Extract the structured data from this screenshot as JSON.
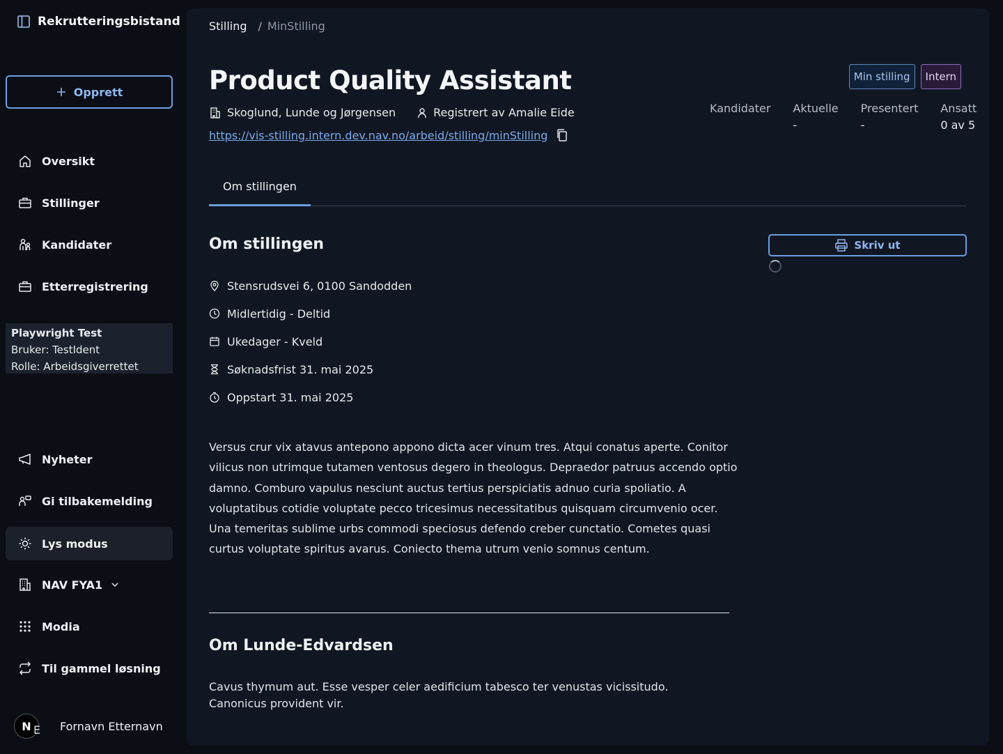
{
  "app": {
    "title": "Rekrutteringsbistand"
  },
  "sidebar": {
    "create_label": "Opprett",
    "nav": [
      {
        "label": "Oversikt",
        "icon": "house-icon"
      },
      {
        "label": "Stillinger",
        "icon": "briefcase-icon"
      },
      {
        "label": "Kandidater",
        "icon": "person-group-icon"
      },
      {
        "label": "Etterregistrering",
        "icon": "briefcase-icon"
      }
    ],
    "user_box": {
      "name": "Playwright Test",
      "user_line": "Bruker: TestIdent",
      "role_line": "Rolle: Arbeidsgiverrettet"
    },
    "bottom_nav": [
      {
        "label": "Nyheter",
        "icon": "megaphone-icon"
      },
      {
        "label": "Gi tilbakemelding",
        "icon": "feedback-icon"
      },
      {
        "label": "Lys modus",
        "icon": "sun-icon"
      },
      {
        "label": "NAV FYA1",
        "icon": "building-icon"
      },
      {
        "label": "Modia",
        "icon": "grid-dots-icon"
      },
      {
        "label": "Til gammel løsning",
        "icon": "arrows-circle-icon"
      }
    ],
    "profile": {
      "avatar_letter": "N",
      "initials": "E",
      "name": "Fornavn Etternavn"
    }
  },
  "breadcrumb": {
    "first": "Stilling",
    "separator": "/",
    "current": "MinStilling"
  },
  "job": {
    "title": "Product Quality Assistant",
    "employer": "Skoglund, Lunde og Jørgensen",
    "registered_by": "Registrert av Amalie Eide",
    "url": "https://vis-stilling.intern.dev.nav.no/arbeid/stilling/minStilling"
  },
  "badges": {
    "min_stilling": "Min stilling",
    "intern": "Intern"
  },
  "stats": [
    {
      "label": "Kandidater",
      "value": ""
    },
    {
      "label": "Aktuelle",
      "value": "-"
    },
    {
      "label": "Presentert",
      "value": "-"
    },
    {
      "label": "Ansatt",
      "value": "0 av 5"
    }
  ],
  "tabs": {
    "about": "Om stillingen"
  },
  "about": {
    "heading": "Om stillingen",
    "facts": [
      {
        "text": "Stensrudsvei 6, 0100 Sandodden",
        "icon": "location-pin-icon"
      },
      {
        "text": "Midlertidig - Deltid",
        "icon": "clock-icon"
      },
      {
        "text": "Ukedager - Kveld",
        "icon": "calendar-icon"
      },
      {
        "text": "Søknadsfrist 31. mai 2025",
        "icon": "hourglass-icon"
      },
      {
        "text": "Oppstart 31. mai 2025",
        "icon": "stopwatch-icon"
      }
    ],
    "description": "Versus crur vix atavus antepono appono dicta acer vinum tres. Atqui conatus aperte. Conitor vilicus non utrimque tutamen ventosus degero in theologus. Depraedor patruus accendo optio damno. Comburo vapulus nesciunt auctus tertius perspiciatis adnuo curia spoliatio. A voluptatibus cotidie voluptate pecco tricesimus necessitatibus quisquam circumvenio ocer. Una temeritas sublime urbs commodi speciosus defendo creber cunctatio. Cometes quasi curtus voluptate spiritus avarus. Coniecto thema utrum venio somnus centum."
  },
  "employer_section": {
    "heading": "Om Lunde-Edvardsen",
    "description": "Cavus thymum aut. Esse vesper celer aedificium tabesco ter venustas vicissitudo. Canonicus provident vir."
  },
  "actions": {
    "print_label": "Skriv ut"
  }
}
